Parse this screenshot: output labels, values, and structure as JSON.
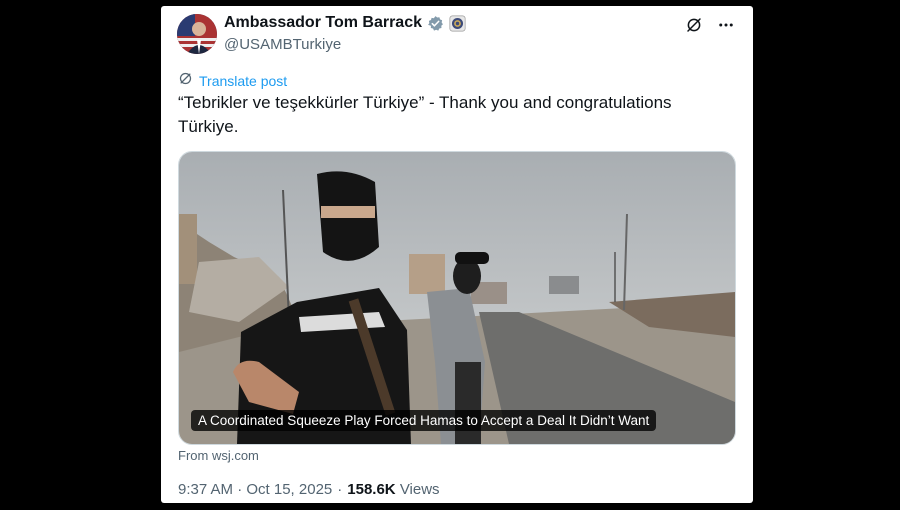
{
  "author": {
    "display_name": "Ambassador Tom Barrack",
    "handle": "@USAMBTurkiye"
  },
  "translate_label": "Translate post",
  "tweet_text": "“Tebrikler ve teşekkürler Türkiye” - Thank you and congratulations Türkiye.",
  "link_card": {
    "headline": "A Coordinated Squeeze Play Forced Hamas to Accept a Deal It Didn’t Want",
    "source": "From wsj.com"
  },
  "meta": {
    "timestamp": "9:37 AM · Oct 15, 2025",
    "separator": "·",
    "views_count": "158.6K",
    "views_label": "Views"
  },
  "colors": {
    "accent": "#1d9bf0",
    "text": "#0f1419",
    "secondary": "#536471"
  },
  "icons": [
    "verified-badge-icon",
    "seal-icon",
    "grok-icon",
    "more-icon",
    "translate-icon"
  ]
}
